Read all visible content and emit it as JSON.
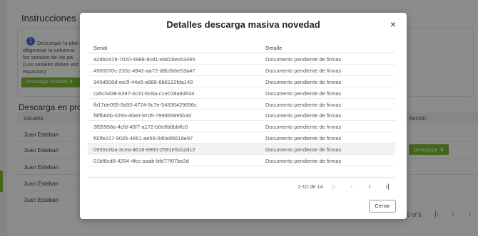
{
  "background": {
    "instructions_title": "Instrucciones",
    "step_number": "1",
    "instructions_lines": [
      "Descargar la plan",
      "diligenciar la columna",
      "los seriales de los pa",
      "(Los seriales deben est",
      "espacios)."
    ],
    "download_template_label": "Descargar Plantilla",
    "section_title": "Descarga en proc",
    "col_user": "Usuario",
    "col_action": "Acción",
    "users": [
      "Juan Esteban",
      "Juan Esteban",
      "Juan Esteban",
      "Juan Esteban",
      "Juan Esteban"
    ],
    "download_button_label": "Descargar",
    "pager_text": "-5 of 5"
  },
  "modal": {
    "title": "Detalles descarga masiva novedad",
    "columns": {
      "serial": "Serial",
      "detail": "Detalle"
    },
    "rows": [
      {
        "serial": "a29b0419-7020-4988-8cd1-e9d28ecb3465",
        "detail": "Documento pendiente de firmas"
      },
      {
        "serial": "4900070c-235c-4942-aa72-d8b3bbe53a47",
        "detail": "Documento pendiente de firmas"
      },
      {
        "serial": "945d906d-ee2f-44e5-a989-8b6122fda143",
        "detail": "Documento pendiente de firmas"
      },
      {
        "serial": "ca5c5438-6397-4c31-bc6a-c1e018a8d634",
        "detail": "Documento pendiente de firmas"
      },
      {
        "serial": "fb17de055-5d90-4724-9c7e-54536429696c",
        "detail": "Documento pendiente de firmas"
      },
      {
        "serial": "f8ffb60b-0293-40e0-97d5-799d65895b3d",
        "detail": "Documento pendiente de firmas"
      },
      {
        "serial": "3f55958a-4cfd-45f7-a172-b0e6b6bbffc0",
        "detail": "Documento pendiente de firmas"
      },
      {
        "serial": "f00fe217-9035-4861-ae58-0d0e95618e97",
        "detail": "Documento pendiente de firmas"
      },
      {
        "serial": "09551eba-3cea-4618-9900-2591e5cb2d12",
        "detail": "Documento pendiente de firmas"
      },
      {
        "serial": "01bf8cd8-4294-4fcc-aaab-bfd77f07be2d",
        "detail": "Documento pendiente de firmas"
      }
    ],
    "pager_range": "1-10 de 14",
    "close_label": "Cerrar"
  },
  "icons": {
    "close": "×",
    "first_page": "|‹",
    "prev_page": "‹",
    "next_page": "›",
    "last_page": "›|",
    "download": "⬇"
  }
}
